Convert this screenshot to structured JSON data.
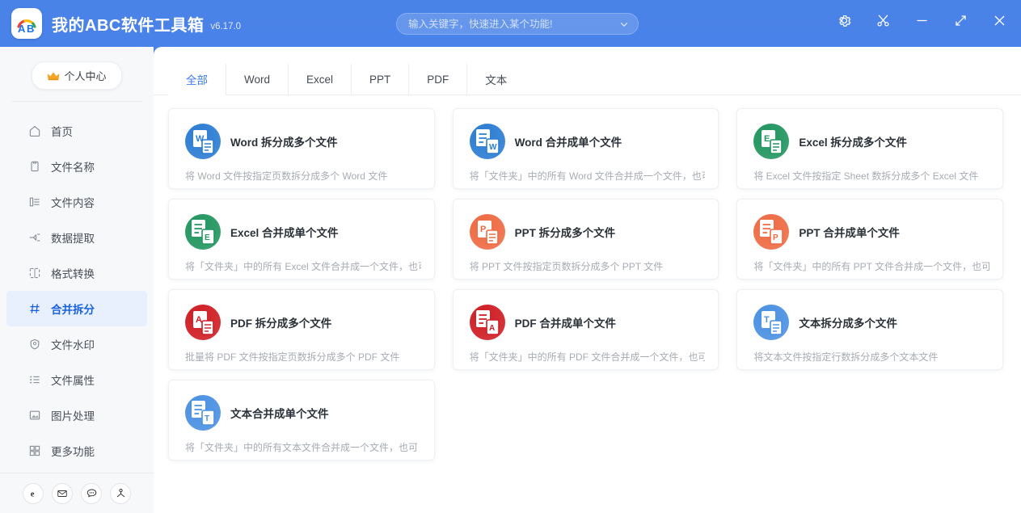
{
  "window": {
    "logo_alt": "abc-logo",
    "title": "我的ABC软件工具箱",
    "version": "v6.17.0",
    "controls": [
      {
        "name": "settings-button",
        "icon": "gear-icon"
      },
      {
        "name": "snip-button",
        "icon": "scissors-icon"
      },
      {
        "name": "minimize-button",
        "icon": "minimize-icon"
      },
      {
        "name": "maximize-button",
        "icon": "expand-icon"
      },
      {
        "name": "close-button",
        "icon": "close-icon"
      }
    ]
  },
  "search": {
    "placeholder": "输入关键字，快速进入某个功能!",
    "value": ""
  },
  "sidebar": {
    "vip_label": "个人中心",
    "items": [
      {
        "label": "首页",
        "icon": "home-icon",
        "active": false
      },
      {
        "label": "文件名称",
        "icon": "file-name-icon",
        "active": false
      },
      {
        "label": "文件内容",
        "icon": "file-content-icon",
        "active": false
      },
      {
        "label": "数据提取",
        "icon": "data-extract-icon",
        "active": false
      },
      {
        "label": "格式转换",
        "icon": "format-convert-icon",
        "active": false
      },
      {
        "label": "合并拆分",
        "icon": "merge-split-icon",
        "active": true
      },
      {
        "label": "文件水印",
        "icon": "watermark-icon",
        "active": false
      },
      {
        "label": "文件属性",
        "icon": "file-properties-icon",
        "active": false
      },
      {
        "label": "图片处理",
        "icon": "image-process-icon",
        "active": false
      },
      {
        "label": "更多功能",
        "icon": "more-functions-icon",
        "active": false
      }
    ],
    "bottom_icons": [
      {
        "name": "browser-icon",
        "glyph": "e"
      },
      {
        "name": "mail-icon",
        "glyph": "✉"
      },
      {
        "name": "chat-icon",
        "glyph": "💬"
      },
      {
        "name": "user-group-icon",
        "glyph": "👤"
      }
    ]
  },
  "tabs": [
    {
      "label": "全部",
      "active": true
    },
    {
      "label": "Word",
      "active": false
    },
    {
      "label": "Excel",
      "active": false
    },
    {
      "label": "PPT",
      "active": false
    },
    {
      "label": "PDF",
      "active": false
    },
    {
      "label": "文本",
      "active": false
    }
  ],
  "colors": {
    "header_blue": "#3f78e6",
    "accent": "#3a7bea",
    "word_blue": "#2b7cd3",
    "excel_green": "#21955f",
    "ppt_orange": "#ee6a43",
    "pdf_red": "#cf1d24",
    "text_blue": "#4a90e2",
    "active_nav_bg": "#e8f0fe"
  },
  "cards": [
    {
      "title": "Word 拆分成多个文件",
      "desc": "将 Word 文件按指定页数拆分成多个 Word 文件",
      "icon": "word-split-icon",
      "color": "#2b7cd3",
      "letter": "W",
      "mode": "split"
    },
    {
      "title": "Word 合并成单个文件",
      "desc": "将「文件夹」中的所有 Word 文件合并成一个文件，也可",
      "icon": "word-merge-icon",
      "color": "#2b7cd3",
      "letter": "W",
      "mode": "merge"
    },
    {
      "title": "Excel 拆分成多个文件",
      "desc": "将 Excel 文件按指定 Sheet 数拆分成多个 Excel 文件",
      "icon": "excel-split-icon",
      "color": "#21955f",
      "letter": "E",
      "mode": "split"
    },
    {
      "title": "Excel 合并成单个文件",
      "desc": "将「文件夹」中的所有 Excel 文件合并成一个文件，也可",
      "icon": "excel-merge-icon",
      "color": "#21955f",
      "letter": "E",
      "mode": "merge"
    },
    {
      "title": "PPT 拆分成多个文件",
      "desc": "将 PPT 文件按指定页数拆分成多个 PPT 文件",
      "icon": "ppt-split-icon",
      "color": "#ee6a43",
      "letter": "P",
      "mode": "split"
    },
    {
      "title": "PPT 合并成单个文件",
      "desc": "将「文件夹」中的所有 PPT 文件合并成一个文件，也可",
      "icon": "ppt-merge-icon",
      "color": "#ee6a43",
      "letter": "P",
      "mode": "merge"
    },
    {
      "title": "PDF 拆分成多个文件",
      "desc": "批量将 PDF 文件按指定页数拆分成多个 PDF 文件",
      "icon": "pdf-split-icon",
      "color": "#cf1d24",
      "letter": "A",
      "mode": "split"
    },
    {
      "title": "PDF 合并成单个文件",
      "desc": "将「文件夹」中的所有 PDF 文件合并成一个文件，也可",
      "icon": "pdf-merge-icon",
      "color": "#cf1d24",
      "letter": "A",
      "mode": "merge"
    },
    {
      "title": "文本拆分成多个文件",
      "desc": "将文本文件按指定行数拆分成多个文本文件",
      "icon": "text-split-icon",
      "color": "#4a90e2",
      "letter": "T",
      "mode": "split"
    },
    {
      "title": "文本合并成单个文件",
      "desc": "将「文件夹」中的所有文本文件合并成一个文件，也可",
      "icon": "text-merge-icon",
      "color": "#4a90e2",
      "letter": "T",
      "mode": "merge"
    }
  ]
}
